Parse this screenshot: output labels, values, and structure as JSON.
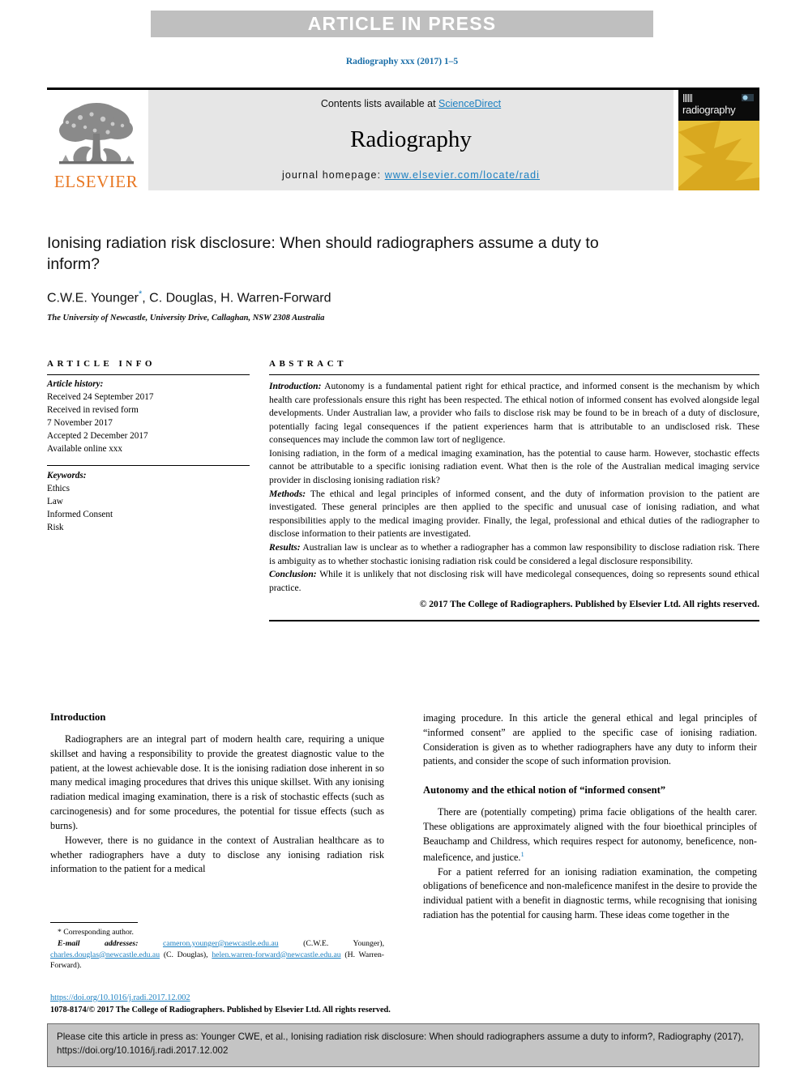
{
  "banner": {
    "text": "ARTICLE IN PRESS"
  },
  "running_head": "Radiography xxx (2017) 1–5",
  "masthead": {
    "contents_prefix": "Contents lists available at ",
    "sciencedirect": "ScienceDirect",
    "journal_name": "Radiography",
    "homepage_prefix": "journal homepage: ",
    "homepage_url": "www.elsevier.com/locate/radi",
    "publisher_wordmark": "ELSEVIER",
    "cover_title": "radiography",
    "colors": {
      "link": "#1a7fc1",
      "elsevier_orange": "#e87722",
      "cover_gold": "#e8c23a",
      "banner_gray": "#bfbfbf"
    }
  },
  "article": {
    "title": "Ionising radiation risk disclosure: When should radiographers assume a duty to inform?",
    "authors": "C.W.E. Younger",
    "authors_rest": ", C. Douglas, H. Warren-Forward",
    "corresponding_marker": "*",
    "affiliation": "The University of Newcastle, University Drive, Callaghan, NSW 2308 Australia"
  },
  "article_info": {
    "label": "ARTICLE INFO",
    "history_head": "Article history:",
    "history": [
      "Received 24 September 2017",
      "Received in revised form",
      "7 November 2017",
      "Accepted 2 December 2017",
      "Available online xxx"
    ],
    "keywords_head": "Keywords:",
    "keywords": [
      "Ethics",
      "Law",
      "Informed Consent",
      "Risk"
    ]
  },
  "abstract": {
    "label": "ABSTRACT",
    "sections": [
      {
        "head": "Introduction:",
        "text": " Autonomy is a fundamental patient right for ethical practice, and informed consent is the mechanism by which health care professionals ensure this right has been respected. The ethical notion of informed consent has evolved alongside legal developments. Under Australian law, a provider who fails to disclose risk may be found to be in breach of a duty of disclosure, potentially facing legal consequences if the patient experiences harm that is attributable to an undisclosed risk. These consequences may include the common law tort of negligence."
      },
      {
        "head": "",
        "text": "Ionising radiation, in the form of a medical imaging examination, has the potential to cause harm. However, stochastic effects cannot be attributable to a specific ionising radiation event. What then is the role of the Australian medical imaging service provider in disclosing ionising radiation risk?"
      },
      {
        "head": "Methods:",
        "text": " The ethical and legal principles of informed consent, and the duty of information provision to the patient are investigated. These general principles are then applied to the specific and unusual case of ionising radiation, and what responsibilities apply to the medical imaging provider. Finally, the legal, professional and ethical duties of the radiographer to disclose information to their patients are investigated."
      },
      {
        "head": "Results:",
        "text": " Australian law is unclear as to whether a radiographer has a common law responsibility to disclose radiation risk. There is ambiguity as to whether stochastic ionising radiation risk could be considered a legal disclosure responsibility."
      },
      {
        "head": "Conclusion:",
        "text": " While it is unlikely that not disclosing risk will have medicolegal consequences, doing so represents sound ethical practice."
      }
    ],
    "copyright": "© 2017 The College of Radiographers. Published by Elsevier Ltd. All rights reserved."
  },
  "body": {
    "left": {
      "heading": "Introduction",
      "paragraphs": [
        "Radiographers are an integral part of modern health care, requiring a unique skillset and having a responsibility to provide the greatest diagnostic value to the patient, at the lowest achievable dose. It is the ionising radiation dose inherent in so many medical imaging procedures that drives this unique skillset. With any ionising radiation medical imaging examination, there is a risk of stochastic effects (such as carcinogenesis) and for some procedures, the potential for tissue effects (such as burns).",
        "However, there is no guidance in the context of Australian healthcare as to whether radiographers have a duty to disclose any ionising radiation risk information to the patient for a medical"
      ]
    },
    "right": {
      "para_continued": "imaging procedure. In this article the general ethical and legal principles of “informed consent” are applied to the specific case of ionising radiation. Consideration is given as to whether radiographers have any duty to inform their patients, and consider the scope of such information provision.",
      "heading": "Autonomy and the ethical notion of “informed consent”",
      "paragraphs": [
        "There are (potentially competing) prima facie obligations of the health carer. These obligations are approximately aligned with the four bioethical principles of Beauchamp and Childress, which requires respect for autonomy, beneficence, non-maleficence, and justice.",
        "For a patient referred for an ionising radiation examination, the competing obligations of beneficence and non-maleficence manifest in the desire to provide the individual patient with a benefit in diagnostic terms, while recognising that ionising radiation has the potential for causing harm. These ideas come together in the"
      ],
      "citation_ref": "1"
    }
  },
  "footnote": {
    "corresponding": "Corresponding author.",
    "email_label": "E-mail addresses:",
    "emails": [
      {
        "address": "cameron.younger@newcastle.edu.au",
        "name": "(C.W.E. Younger)"
      },
      {
        "address": "charles.douglas@newcastle.edu.au",
        "name": "(C. Douglas)"
      },
      {
        "address": "helen.warren-forward@newcastle.edu.au",
        "name": "(H. Warren-Forward)"
      }
    ]
  },
  "doi_block": {
    "doi": "https://doi.org/10.1016/j.radi.2017.12.002",
    "issn_line": "1078-8174/© 2017 The College of Radiographers. Published by Elsevier Ltd. All rights reserved."
  },
  "citation_box": {
    "text": "Please cite this article in press as: Younger CWE, et al., Ionising radiation risk disclosure: When should radiographers assume a duty to inform?, Radiography (2017), https://doi.org/10.1016/j.radi.2017.12.002"
  }
}
